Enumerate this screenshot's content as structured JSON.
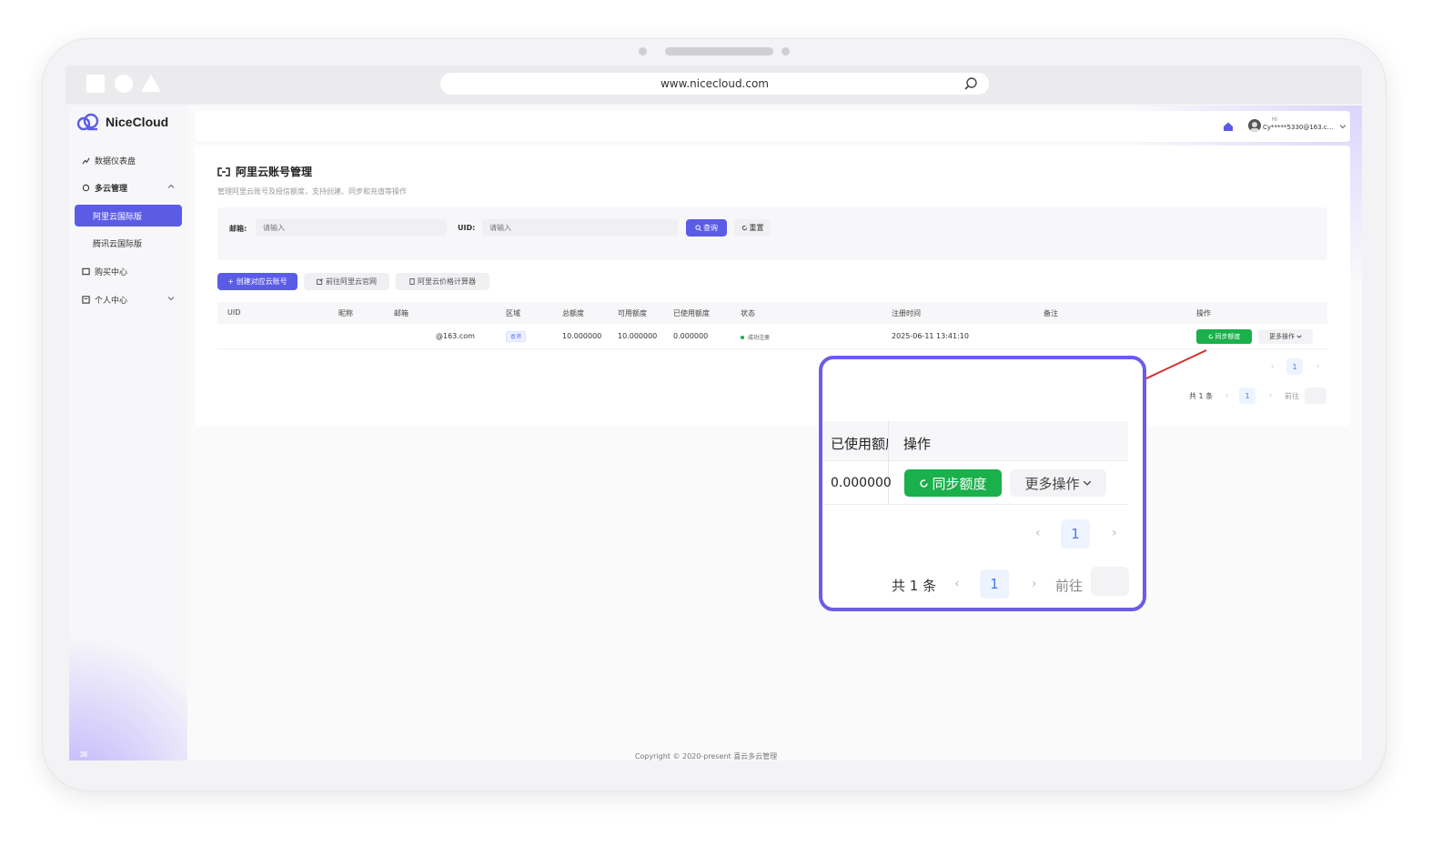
{
  "browser": {
    "url": "www.nicecloud.com"
  },
  "sidebar": {
    "logo_text": "NiceCloud",
    "items": [
      {
        "label": "数据仪表盘"
      },
      {
        "label": "多云管理"
      },
      {
        "label": "阿里云国际版"
      },
      {
        "label": "腾讯云国际版"
      },
      {
        "label": "购买中心"
      },
      {
        "label": "个人中心"
      }
    ]
  },
  "header": {
    "greeting": "Hi",
    "user_email": "Cy*****5330@163.c..."
  },
  "page": {
    "title": "阿里云账号管理",
    "description": "管理阿里云账号及授信额度，支持创建、同步和充值等操作"
  },
  "filter": {
    "email_label": "邮箱:",
    "email_placeholder": "请输入",
    "uid_label": "UID:",
    "uid_placeholder": "请输入",
    "query_label": "查询",
    "reset_label": "重置"
  },
  "actions": {
    "create_label": "+ 创建对应云账号",
    "goto_label": "前往阿里云官网",
    "calc_label": "阿里云价格计算器"
  },
  "table": {
    "columns": [
      "UID",
      "昵称",
      "邮箱",
      "区域",
      "总额度",
      "可用额度",
      "已使用额度",
      "状态",
      "注册时间",
      "备注",
      "操作"
    ],
    "rows": [
      {
        "uid": "",
        "nickname": "",
        "email": "@163.com",
        "region": "香港",
        "total": "10.000000",
        "available": "10.000000",
        "used": "0.000000",
        "status": "成功注册",
        "registered": "2025-06-11 13:41:10",
        "remark": "",
        "sync_label": "同步额度",
        "more_label": "更多操作"
      }
    ]
  },
  "pagination": {
    "current": "1",
    "total_text": "共 1 条",
    "goto_label": "前往"
  },
  "zoom": {
    "col_used": "已使用额度",
    "col_ops": "操作",
    "used_value": "0.000000",
    "sync_label": "同步额度",
    "more_label": "更多操作",
    "page": "1",
    "total_text": "共 1 条",
    "goto_label": "前往"
  },
  "footer": {
    "copyright": "Copyright © 2020-present 喜云多云管理"
  },
  "colors": {
    "primary": "#5b5ce6",
    "success": "#1ab04b",
    "callout": "#6c5ce7",
    "arrow": "#d0312d"
  }
}
